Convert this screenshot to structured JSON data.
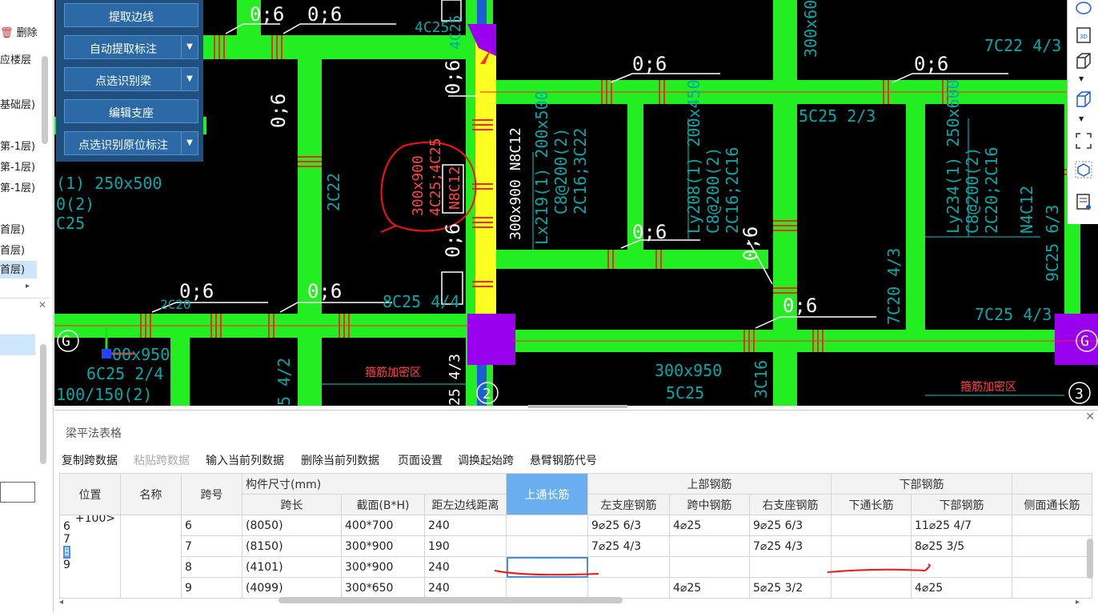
{
  "left_panel": {
    "delete_label": "删除",
    "floors": [
      "应楼层",
      "基础层)",
      "第-1层)",
      "第-1层)",
      "第-1层)",
      "首层)",
      "首层)",
      "首层)"
    ]
  },
  "menu": {
    "items": [
      {
        "label": "提取边线",
        "has_dropdown": false
      },
      {
        "label": "自动提取标注",
        "has_dropdown": true
      },
      {
        "label": "点选识别梁",
        "has_dropdown": true
      },
      {
        "label": "编辑支座",
        "has_dropdown": false
      },
      {
        "label": "点选识别原位标注",
        "has_dropdown": true
      }
    ]
  },
  "canvas": {
    "texts": {
      "t1": "0;6",
      "t2": "0;6",
      "t3": "4C25",
      "t4": "0;6",
      "t5": "0;6",
      "t6": "0;6",
      "t7": "300x600",
      "t8": "7C22 4/3",
      "t9": "4C25",
      "t10": "0;6",
      "t11": "5C25 2/3",
      "t12": "300x900 N8C12",
      "t13": "Lx219(1) 200x500",
      "t14": "C8@200(2)",
      "t15": "2C16;3C22",
      "t16": "Ly208(1) 200x450",
      "t17": "C8@200(2)",
      "t18": "2C16;2C16",
      "t19": "Ly234(1) 250x600",
      "t20": "C8@200(2)",
      "t21": "2C20;2C16",
      "t22": "N4C12",
      "t23": "9C25 6/3",
      "t24": "(1) 250x500",
      "t25": "0(2)",
      "t26": "C25",
      "t27": "2C22",
      "t28": "300x900",
      "t29": "4C25;4C25",
      "t30": "N8C12",
      "t31": "0;6",
      "t32": "0;6",
      "t33": "0;6",
      "t34": "0;6",
      "t35": "0;6",
      "t36": "0;6",
      "t37": "8C25 4/4",
      "t38": "7C20 4/3",
      "t39": "7C25 4/3",
      "t40": "2C20",
      "t41": "G",
      "t42": "G",
      "t43": "00x950",
      "t44": "6C25 2/4",
      "t45": "100/150(2)",
      "t46": "5 4/2",
      "t47": "箍筋加密区",
      "t48": "25 4/3",
      "t49": "2",
      "t50": "300x950",
      "t51": "5C25",
      "t52": "3C16",
      "t53": "箍筋加密区",
      "t54": "3"
    }
  },
  "bottom_panel": {
    "title": "梁平法表格",
    "toolbar": [
      "复制跨数据",
      "粘贴跨数据",
      "输入当前列数据",
      "删除当前列数据",
      "页面设置",
      "调换起始跨",
      "悬臂钢筋代号"
    ],
    "headers": {
      "position": "位置",
      "name": "名称",
      "span_no": "跨号",
      "size_group": "构件尺寸(mm)",
      "span_len": "跨长",
      "section": "截面(B*H)",
      "left_dist": "距左边线距离",
      "top_through": "上通长筋",
      "top_group": "上部钢筋",
      "left_seat": "左支座钢筋",
      "mid_span": "跨中钢筋",
      "right_seat": "右支座钢筋",
      "bottom_group": "下部钢筋",
      "bottom_through": "下通长筋",
      "bottom_bar": "下部钢筋",
      "side_through": "侧面通长筋"
    },
    "position_text": "+100>",
    "row_nums": [
      "6",
      "7",
      "8",
      "9"
    ],
    "rows": [
      {
        "span": "6",
        "len": "(8050)",
        "sec": "400*700",
        "dist": "240",
        "top": "",
        "left": "9⌀25 6/3",
        "mid": "4⌀25",
        "right": "9⌀25 6/3",
        "bthr": "",
        "bot": "11⌀25 4/7",
        "side": ""
      },
      {
        "span": "7",
        "len": "(8150)",
        "sec": "300*900",
        "dist": "190",
        "top": "",
        "left": "7⌀25 4/3",
        "mid": "",
        "right": "7⌀25 4/3",
        "bthr": "",
        "bot": "8⌀25 3/5",
        "side": ""
      },
      {
        "span": "8",
        "len": "(4101)",
        "sec": "300*900",
        "dist": "240",
        "top": "",
        "left": "",
        "mid": "",
        "right": "",
        "bthr": "",
        "bot": "",
        "side": ""
      },
      {
        "span": "9",
        "len": "(4099)",
        "sec": "300*650",
        "dist": "240",
        "top": "",
        "left": "",
        "mid": "4⌀25",
        "right": "5⌀25 3/2",
        "bthr": "",
        "bot": "4⌀25",
        "side": ""
      }
    ]
  }
}
